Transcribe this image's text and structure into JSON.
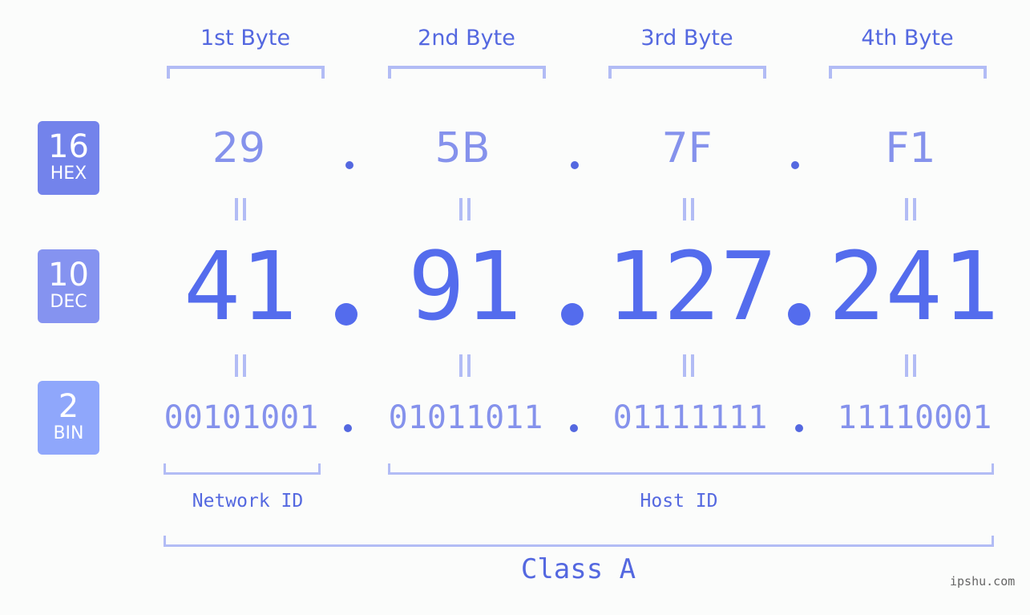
{
  "bytes": {
    "labels": [
      "1st Byte",
      "2nd Byte",
      "3rd Byte",
      "4th Byte"
    ]
  },
  "bases": {
    "hex": {
      "number": "16",
      "label": "HEX",
      "color": "#7383eb"
    },
    "dec": {
      "number": "10",
      "label": "DEC",
      "color": "#8593f0"
    },
    "bin": {
      "number": "2",
      "label": "BIN",
      "color": "#8fa7fb"
    }
  },
  "ip": {
    "hex": [
      "29",
      "5B",
      "7F",
      "F1"
    ],
    "dec": [
      "41",
      "91",
      "127",
      "241"
    ],
    "bin": [
      "00101001",
      "01011011",
      "01111111",
      "11110001"
    ]
  },
  "segments": {
    "network_id": "Network ID",
    "host_id": "Host ID",
    "class": "Class A"
  },
  "watermark": "ipshu.com",
  "colors": {
    "accent": "#546ced",
    "bracket": "#b2bcf5",
    "background": "#fbfcfb"
  }
}
